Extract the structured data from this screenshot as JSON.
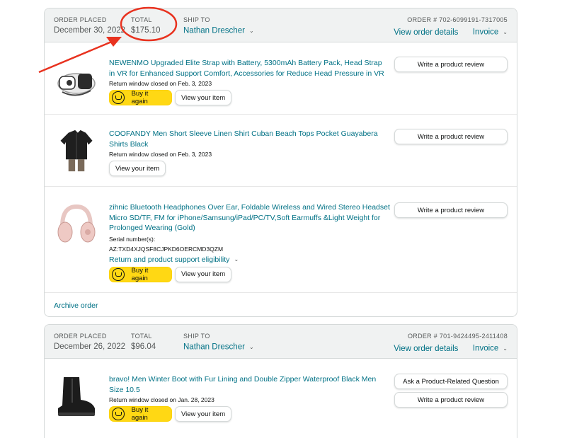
{
  "orders": [
    {
      "labels": {
        "placed": "ORDER PLACED",
        "total": "TOTAL",
        "ship_to": "SHIP TO"
      },
      "placed": "December 30, 2022",
      "total": "$175.10",
      "ship_to": "Nathan Drescher",
      "order_number": "ORDER # 702-6099191-7317005",
      "view_details": "View order details",
      "invoice": "Invoice",
      "items": [
        {
          "title": "NEWENMO Upgraded Elite Strap with Battery, 5300mAh Battery Pack, Head Strap in VR for Enhanced Support Comfort, Accessories for Reduce Head Pressure in VR",
          "return_note": "Return window closed on Feb. 3, 2023",
          "buy_again": "Buy it again",
          "view_item": "View your item",
          "review": "Write a product review",
          "thumbnail": "vr-strap-image"
        },
        {
          "title": "COOFANDY Men Short Sleeve Linen Shirt Cuban Beach Tops Pocket Guayabera Shirts Black",
          "return_note": "Return window closed on Feb. 3, 2023",
          "view_item": "View your item",
          "review": "Write a product review",
          "thumbnail": "black-shirt-image"
        },
        {
          "title": "zihnic Bluetooth Headphones Over Ear, Foldable Wireless and Wired Stereo Headset Micro SD/TF, FM for iPhone/Samsung/iPad/PC/TV,Soft Earmuffs &Light Weight for Prolonged Wearing (Gold)",
          "serial_label": "Serial number(s):",
          "serial_value": "AZ:TXD4XJQSF8CJPKD6OERCMD3QZM",
          "support_link": "Return and product support eligibility",
          "buy_again": "Buy it again",
          "view_item": "View your item",
          "review": "Write a product review",
          "thumbnail": "headphones-image"
        }
      ],
      "archive": "Archive order"
    },
    {
      "labels": {
        "placed": "ORDER PLACED",
        "total": "TOTAL",
        "ship_to": "SHIP TO"
      },
      "placed": "December 26, 2022",
      "total": "$96.04",
      "ship_to": "Nathan Drescher",
      "order_number": "ORDER # 701-9424495-2411408",
      "view_details": "View order details",
      "invoice": "Invoice",
      "items": [
        {
          "title": "bravo! Men Winter Boot with Fur Lining and Double Zipper Waterproof Black Men Size 10.5",
          "return_note": "Return window closed on Jan. 28, 2023",
          "buy_again": "Buy it again",
          "view_item": "View your item",
          "question": "Ask a Product-Related Question",
          "review": "Write a product review",
          "thumbnail": "winter-boot-image"
        }
      ]
    }
  ],
  "colors": {
    "link": "#007185",
    "buy_button": "#ffd814",
    "annotation": "#e8321f",
    "header_bg": "#f0f2f2"
  }
}
